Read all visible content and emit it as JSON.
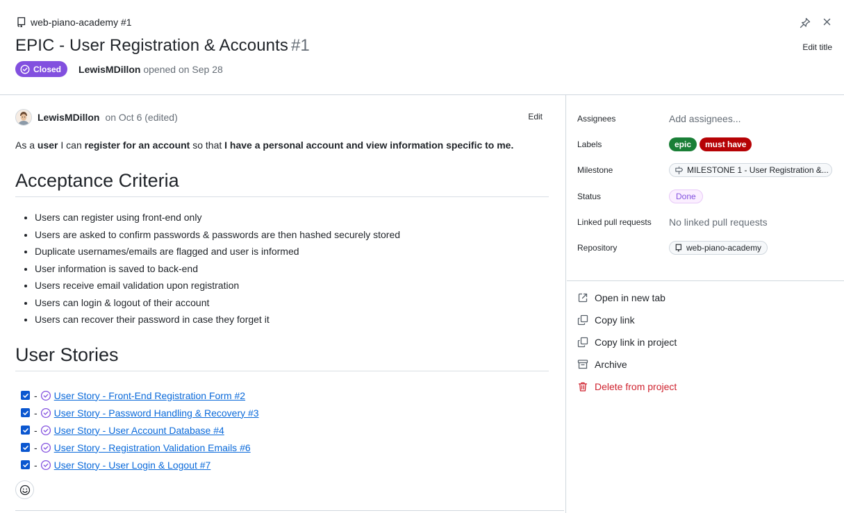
{
  "header": {
    "repo_ref": "web-piano-academy #1",
    "title": "EPIC - User Registration & Accounts",
    "number": "#1",
    "state": "Closed",
    "author": "LewisMDillon",
    "opened_text": "opened on Sep 28",
    "edit_title_label": "Edit title",
    "icons": [
      "repo-icon",
      "pin-icon",
      "close-icon",
      "issue-closed-icon"
    ]
  },
  "comment": {
    "author": "LewisMDillon",
    "meta": "on Oct 6 (edited)",
    "edit_label": "Edit",
    "body": {
      "p1": "As a ",
      "b1": "user",
      "p2": " I can ",
      "b2": "register for an account",
      "p3": " so that ",
      "b3": "I have a personal account and view information specific to me."
    },
    "sections": {
      "acceptance_title": "Acceptance Criteria",
      "stories_title": "User Stories"
    },
    "criteria": [
      "Users can register using front-end only",
      "Users are asked to confirm passwords & passwords are then hashed securely stored",
      "Duplicate usernames/emails are flagged and user is informed",
      "User information is saved to back-end",
      "Users receive email validation upon registration",
      "Users can login & logout of their account",
      "Users can recover their password in case they forget it"
    ],
    "stories": [
      {
        "dash": "-",
        "link": "User Story - Front-End Registration Form #2"
      },
      {
        "dash": "-",
        "link": "User Story - Password Handling & Recovery #3"
      },
      {
        "dash": "-",
        "link": "User Story - User Account Database #4"
      },
      {
        "dash": "-",
        "link": "User Story - Registration Validation Emails #6"
      },
      {
        "dash": "-",
        "link": "User Story - User Login & Logout #7"
      }
    ]
  },
  "sidebar": {
    "fields": {
      "assignees": {
        "label": "Assignees",
        "value": "Add assignees..."
      },
      "labels": {
        "label": "Labels",
        "items": [
          "epic",
          "must have"
        ]
      },
      "milestone": {
        "label": "Milestone",
        "value": "MILESTONE 1 - User Registration &..."
      },
      "status": {
        "label": "Status",
        "value": "Done"
      },
      "linked_prs": {
        "label": "Linked pull requests",
        "value": "No linked pull requests"
      },
      "repository": {
        "label": "Repository",
        "value": "web-piano-academy"
      }
    },
    "actions": [
      {
        "label": "Open in new tab",
        "icon": "external-link-icon"
      },
      {
        "label": "Copy link",
        "icon": "copy-icon"
      },
      {
        "label": "Copy link in project",
        "icon": "copy-icon"
      },
      {
        "label": "Archive",
        "icon": "archive-icon"
      },
      {
        "label": "Delete from project",
        "icon": "trash-icon"
      }
    ]
  },
  "colors": {
    "closed_badge": "#8250df",
    "label_epic": "#1a7f37",
    "label_must_have": "#b60205",
    "link": "#0969da",
    "danger": "#cf222e",
    "checkbox": "#0b57d0"
  }
}
